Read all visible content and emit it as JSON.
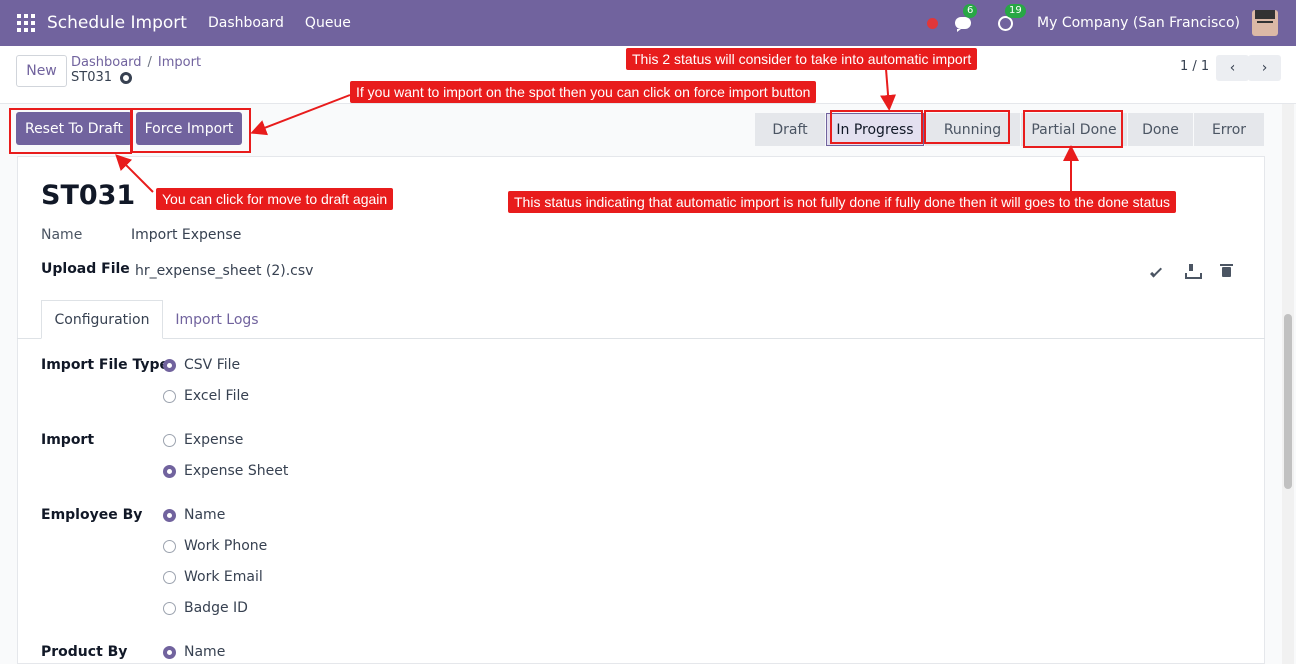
{
  "navbar": {
    "app_title": "Schedule Import",
    "menu": [
      "Dashboard",
      "Queue"
    ],
    "chat_count": "6",
    "activity_count": "19",
    "company": "My Company (San Francisco)"
  },
  "control_panel": {
    "new_label": "New",
    "breadcrumb": [
      "Dashboard",
      "Import"
    ],
    "breadcrumb_sep": "/",
    "record_ref": "ST031",
    "pager": "1 / 1",
    "prev_glyph": "‹",
    "next_glyph": "›"
  },
  "actions": {
    "reset_to_draft": "Reset To Draft",
    "force_import": "Force Import"
  },
  "statusbar": {
    "stages": [
      "Draft",
      "In Progress",
      "Running",
      "Partial Done",
      "Done",
      "Error"
    ],
    "current": "In Progress"
  },
  "form": {
    "title": "ST031",
    "name_label": "Name",
    "name_value": "Import Expense",
    "upload_label": "Upload File",
    "upload_value": "hr_expense_sheet (2).csv",
    "tabs": [
      "Configuration",
      "Import Logs"
    ],
    "import_file_type": {
      "label": "Import File Type",
      "options": [
        "CSV File",
        "Excel File"
      ],
      "selected": "CSV File"
    },
    "import": {
      "label": "Import",
      "options": [
        "Expense",
        "Expense Sheet"
      ],
      "selected": "Expense Sheet"
    },
    "employee_by": {
      "label": "Employee By",
      "options": [
        "Name",
        "Work Phone",
        "Work Email",
        "Badge ID"
      ],
      "selected": "Name"
    },
    "product_by": {
      "label": "Product By",
      "options": [
        "Name"
      ],
      "selected": "Name"
    }
  },
  "annotations": {
    "force_note": "If you want to import on the spot then you can click on force import button",
    "status_note": "This 2 status will consider to take into automatic import",
    "draft_note": "You can click for move to draft again",
    "partial_note": "This status indicating that automatic import is not fully done if fully done then it will goes to the done status"
  },
  "colors": {
    "brand": "#71639e",
    "annotation": "#e81c1c",
    "badge": "#28a745"
  }
}
